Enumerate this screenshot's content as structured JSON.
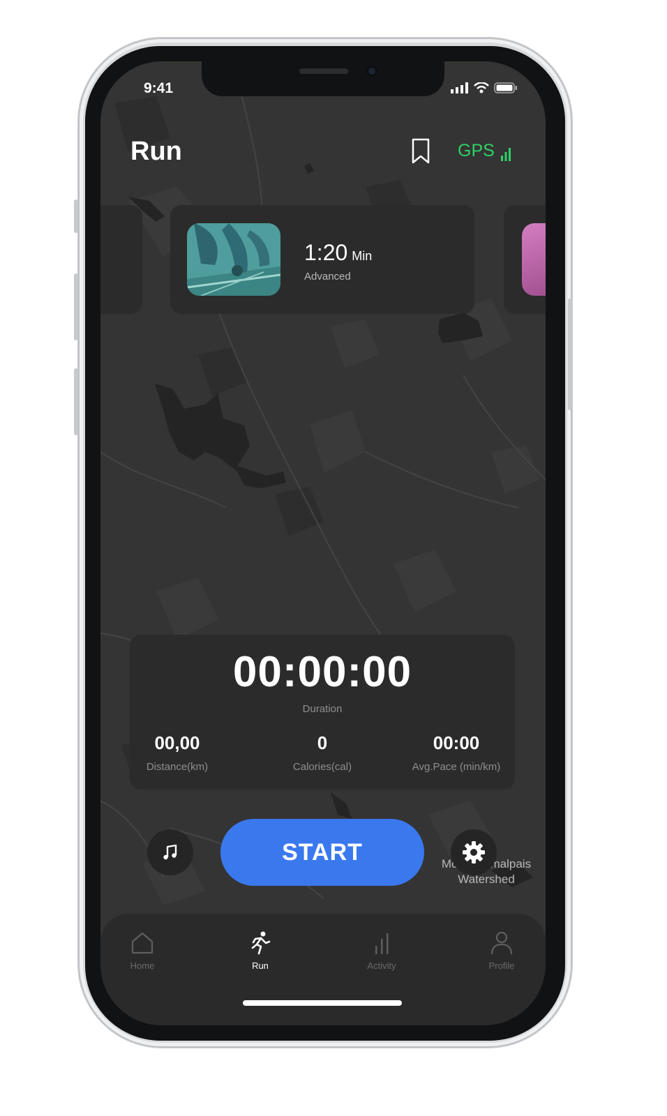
{
  "status_bar": {
    "time": "9:41"
  },
  "header": {
    "title": "Run",
    "gps_label": "GPS"
  },
  "workout_card": {
    "duration": "1:20",
    "unit": "Min",
    "level": "Advanced"
  },
  "stats": {
    "duration": "00:00:00",
    "duration_label": "Duration",
    "metrics": [
      {
        "value": "00,00",
        "label": "Distance(km)"
      },
      {
        "value": "0",
        "label": "Calories(cal)"
      },
      {
        "value": "00:00",
        "label": "Avg.Pace (min/km)"
      }
    ]
  },
  "controls": {
    "start_label": "START"
  },
  "map": {
    "place_label": "Mount Tamalpais Watershed"
  },
  "tabbar": {
    "items": [
      {
        "label": "Home",
        "icon": "home-icon",
        "active": false
      },
      {
        "label": "Run",
        "icon": "runner-icon",
        "active": true
      },
      {
        "label": "Activity",
        "icon": "chart-icon",
        "active": false
      },
      {
        "label": "Profile",
        "icon": "person-icon",
        "active": false
      }
    ]
  },
  "colors": {
    "accent": "#3a78ee",
    "gps": "#2fd066",
    "background": "#333333",
    "card": "#2b2b2b"
  }
}
